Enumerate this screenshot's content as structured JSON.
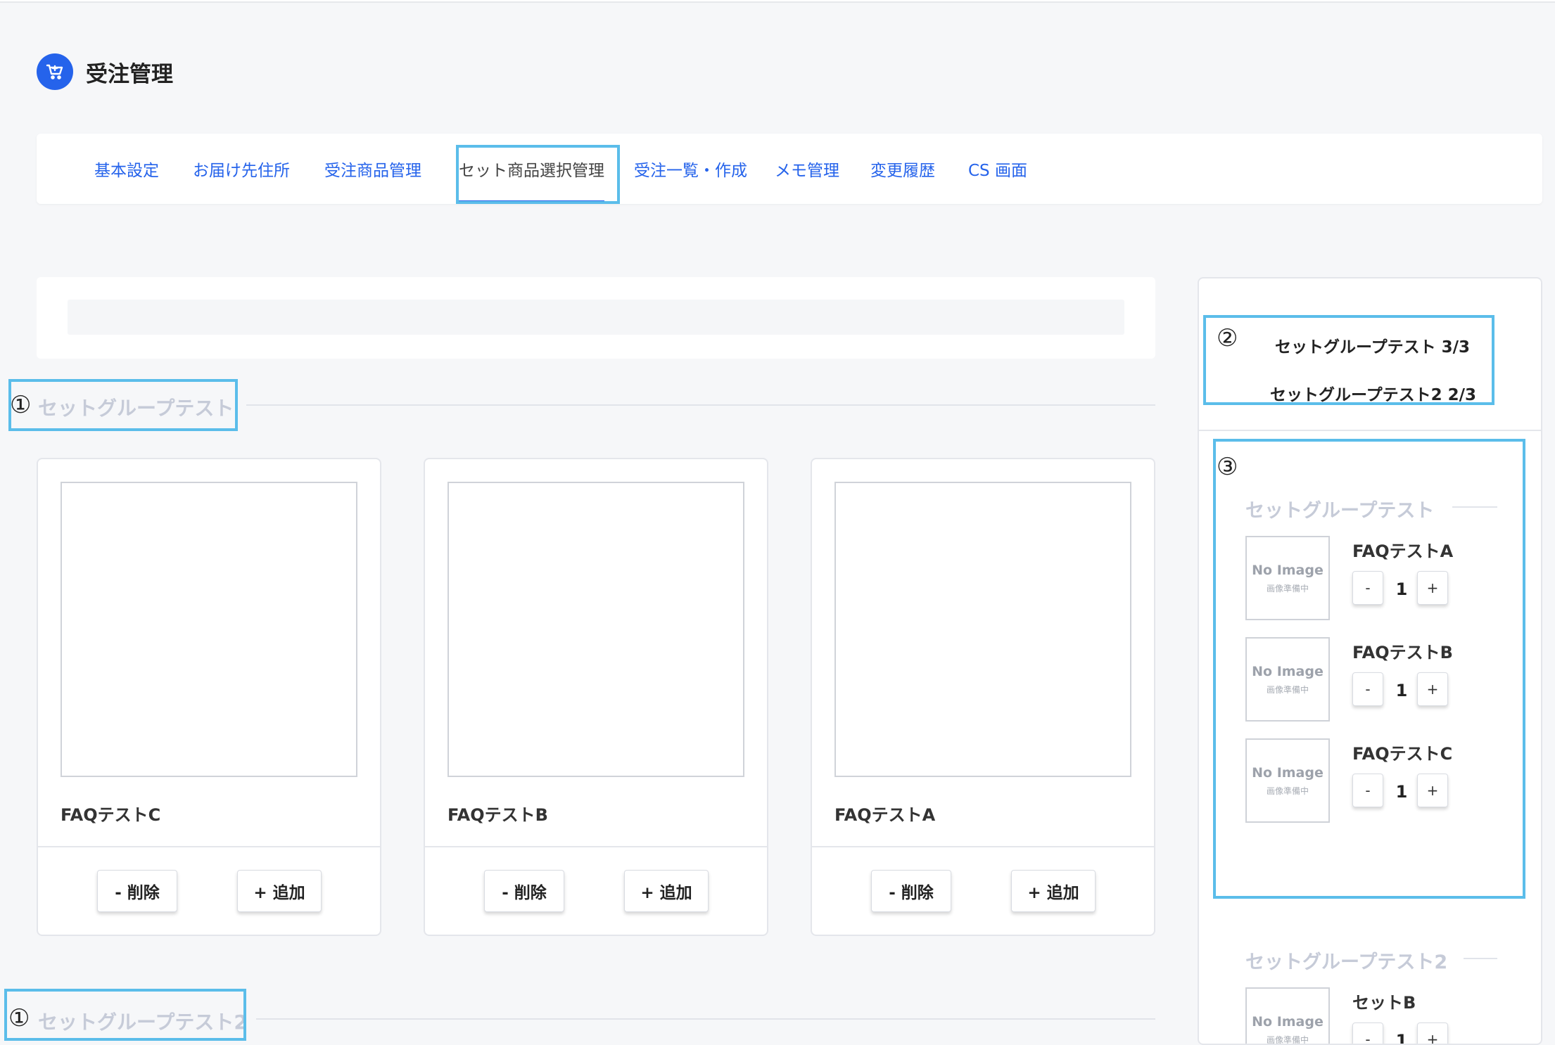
{
  "header": {
    "title": "受注管理",
    "icon": "cart-icon",
    "accent": "#2563eb"
  },
  "tabs": [
    {
      "label": "基本設定"
    },
    {
      "label": "お届け先住所"
    },
    {
      "label": "受注商品管理"
    },
    {
      "label": "セット商品選択管理",
      "active": true
    },
    {
      "label": "受注一覧・作成"
    },
    {
      "label": "メモ管理"
    },
    {
      "label": "変更履歴"
    },
    {
      "label": "CS 画面"
    }
  ],
  "annotations": {
    "one": "①",
    "two": "②",
    "three": "③"
  },
  "highlight_color": "#5bbdea",
  "groups": [
    {
      "title": "セットグループテスト",
      "products": [
        {
          "name": "FAQテストC",
          "remove_label": "- 削除",
          "add_label": "+ 追加"
        },
        {
          "name": "FAQテストB",
          "remove_label": "- 削除",
          "add_label": "+ 追加"
        },
        {
          "name": "FAQテストA",
          "remove_label": "- 削除",
          "add_label": "+ 追加"
        }
      ]
    },
    {
      "title": "セットグループテスト2"
    }
  ],
  "sidebar": {
    "summary": [
      {
        "label": "セットグループテスト 3/3"
      },
      {
        "label": "セットグループテスト2 2/3"
      }
    ],
    "no_image": {
      "title": "No Image",
      "subtitle": "画像準備中"
    },
    "minus": "-",
    "plus": "+",
    "groups": [
      {
        "title": "セットグループテスト",
        "items": [
          {
            "name": "FAQテストA",
            "qty": "1"
          },
          {
            "name": "FAQテストB",
            "qty": "1"
          },
          {
            "name": "FAQテストC",
            "qty": "1"
          }
        ]
      },
      {
        "title": "セットグループテスト2",
        "items": [
          {
            "name": "セットB",
            "qty": "1"
          }
        ]
      }
    ]
  }
}
